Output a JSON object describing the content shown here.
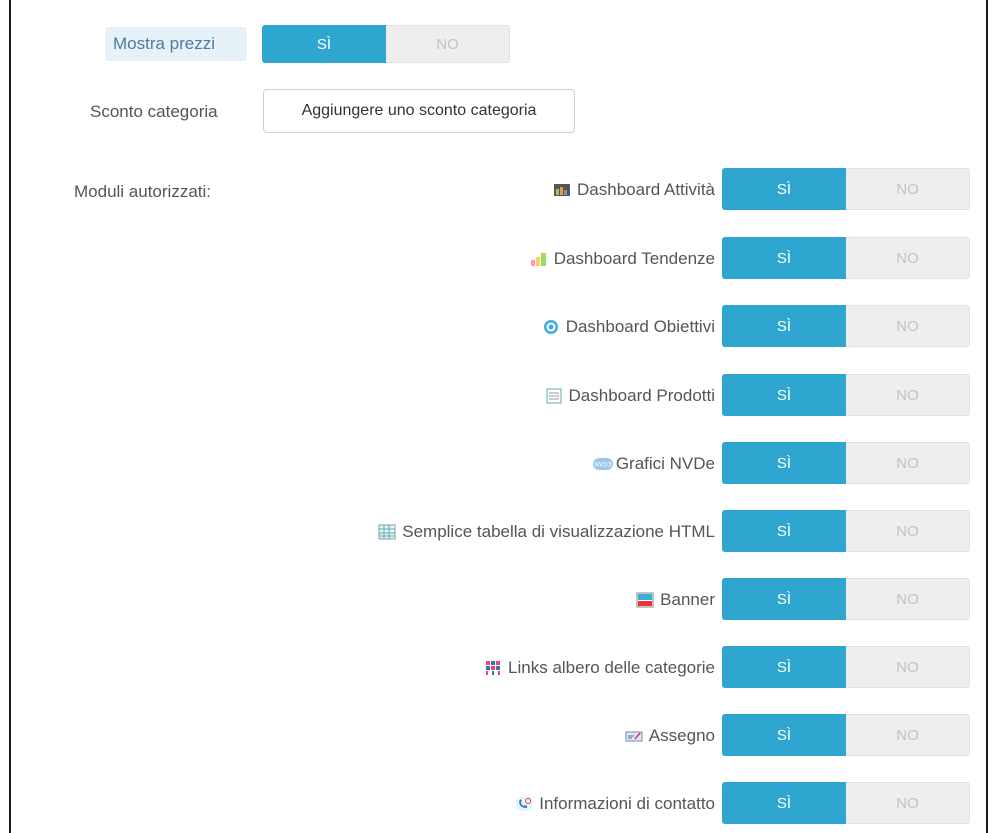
{
  "price_row": {
    "label": "Mostra prezzi",
    "yes": "SÌ",
    "no": "NO",
    "value": "SÌ"
  },
  "discount_row": {
    "label": "Sconto categoria",
    "button": "Aggiungere uno sconto categoria"
  },
  "modules": {
    "label": "Moduli autorizzati:",
    "items": [
      {
        "label": "Dashboard Attività",
        "icon": "dashboard-activity-icon",
        "yes": "SÌ",
        "no": "NO",
        "value": "SÌ"
      },
      {
        "label": "Dashboard Tendenze",
        "icon": "trends-chart-icon",
        "yes": "SÌ",
        "no": "NO",
        "value": "SÌ"
      },
      {
        "label": "Dashboard Obiettivi",
        "icon": "target-icon",
        "yes": "SÌ",
        "no": "NO",
        "value": "SÌ"
      },
      {
        "label": "Dashboard Prodotti",
        "icon": "product-list-icon",
        "yes": "SÌ",
        "no": "NO",
        "value": "SÌ"
      },
      {
        "label": "Grafici NVDe",
        "icon": "nvd3-icon",
        "yes": "SÌ",
        "no": "NO",
        "value": "SÌ"
      },
      {
        "label": "Semplice tabella di visualizzazione HTML",
        "icon": "table-grid-icon",
        "yes": "SÌ",
        "no": "NO",
        "value": "SÌ"
      },
      {
        "label": "Banner",
        "icon": "banner-icon",
        "yes": "SÌ",
        "no": "NO",
        "value": "SÌ"
      },
      {
        "label": "Links albero delle categorie",
        "icon": "category-tree-icon",
        "yes": "SÌ",
        "no": "NO",
        "value": "SÌ"
      },
      {
        "label": "Assegno",
        "icon": "cheque-icon",
        "yes": "SÌ",
        "no": "NO",
        "value": "SÌ"
      },
      {
        "label": "Informazioni di contatto",
        "icon": "contact-phone-icon",
        "yes": "SÌ",
        "no": "NO",
        "value": "SÌ"
      }
    ]
  },
  "colors": {
    "accent": "#2ea6cf",
    "toggle_off": "#eeeeee",
    "label_highlight": "#e6f1f8"
  }
}
